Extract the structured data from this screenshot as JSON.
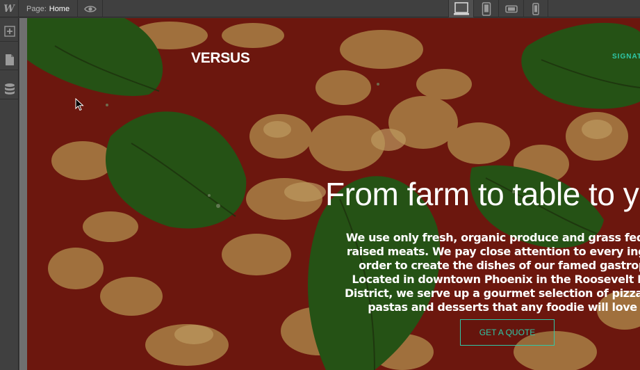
{
  "toolbar": {
    "logo": "W",
    "page_prefix": "Page:",
    "page_name": "Home",
    "preview_icon": "eye-icon",
    "devices": [
      {
        "name": "desktop",
        "icon": "desktop-icon",
        "active": true
      },
      {
        "name": "tablet",
        "icon": "tablet-icon",
        "active": false
      },
      {
        "name": "phone-landscape",
        "icon": "phone-landscape-icon",
        "active": false
      },
      {
        "name": "phone-portrait",
        "icon": "phone-portrait-icon",
        "active": false
      }
    ]
  },
  "sidebar": {
    "items": [
      {
        "name": "add",
        "icon": "plus-icon"
      },
      {
        "name": "pages",
        "icon": "page-icon"
      },
      {
        "name": "cms",
        "icon": "database-icon"
      }
    ]
  },
  "site": {
    "brand": "VERSUS",
    "nav_link": "SIGNAT",
    "hero_title": "From farm to table to y",
    "hero_lines": [
      "We use only fresh, organic produce and grass fed, e",
      "raised meats. We pay close attention to every ingre",
      "order to create the dishes of our famed gastrop",
      "Located in downtown Phoenix in the Roosevelt Ro",
      "District, we serve up a gourmet selection of pizzas, l",
      "pastas and desserts that any foodie will love"
    ],
    "cta_label": "GET A QUOTE"
  },
  "colors": {
    "accent": "#2fc9a8",
    "chrome": "#404040",
    "text": "#ffffff"
  }
}
